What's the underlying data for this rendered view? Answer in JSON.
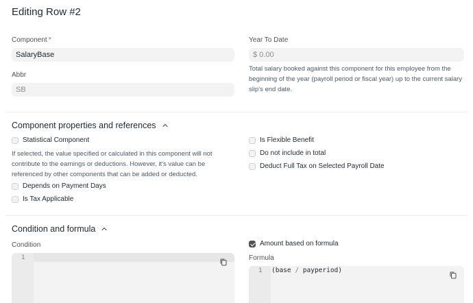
{
  "dialog": {
    "title": "Editing Row #2"
  },
  "details": {
    "component_label": "Component",
    "component_required": "*",
    "component_value": "SalaryBase",
    "abbr_label": "Abbr",
    "abbr_placeholder": "SB",
    "ytd_label": "Year To Date",
    "ytd_placeholder": "$ 0.00",
    "ytd_description": "Total salary booked against this component for this employee from the beginning of the year (payroll period or fiscal year) up to the current salary slip's end date."
  },
  "properties": {
    "title": "Component properties and references",
    "statistical_component": {
      "label": "Statistical Component",
      "checked": false
    },
    "statistical_description": "If selected, the value specified or calculated in this component will not contribute to the earnings or deductions. However, it's value can be referenced by other components that can be added or deducted.",
    "depends_on_payment_days": {
      "label": "Depends on Payment Days",
      "checked": false
    },
    "is_tax_applicable": {
      "label": "Is Tax Applicable",
      "checked": false
    },
    "is_flexible_benefit": {
      "label": "Is Flexible Benefit",
      "checked": false
    },
    "do_not_include_in_total": {
      "label": "Do not include in total",
      "checked": false
    },
    "deduct_full_tax": {
      "label": "Deduct Full Tax on Selected Payroll Date",
      "checked": false
    }
  },
  "formula_section": {
    "title": "Condition and formula",
    "condition_label": "Condition",
    "condition_line_number": "1",
    "condition_code": "",
    "amount_based_on_formula": {
      "label": "Amount based on formula",
      "checked": true
    },
    "formula_label": "Formula",
    "formula_line_number": "1",
    "formula_code_open": "(base ",
    "formula_code_operator": "/",
    "formula_code_close": " payperiod)"
  },
  "icons": {
    "section_toggle": "chevron-up-icon",
    "copy": "copy-icon"
  },
  "colors": {
    "required": "#e24c4c",
    "field_bg": "#f3f3f3",
    "checked": "#525252"
  }
}
